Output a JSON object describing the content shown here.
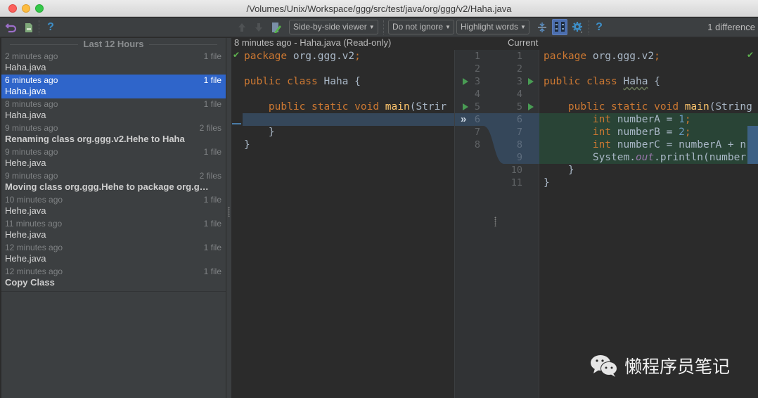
{
  "window": {
    "title": "/Volumes/Unix/Workspace/ggg/src/test/java/org/ggg/v2/Haha.java"
  },
  "left_toolbar": {
    "icons": [
      "revert-icon",
      "file-icon",
      "help-icon"
    ],
    "help_glyph": "?"
  },
  "right_toolbar": {
    "viewer_mode": "Side-by-side viewer",
    "ignore_mode": "Do not ignore",
    "highlight_mode": "Highlight words",
    "help_glyph": "?",
    "difference_count": "1 difference",
    "colors": {
      "accent_blue": "#3d8ec7",
      "selected_toggle": "#4b6eaf"
    }
  },
  "history": {
    "group_label": "Last 12 Hours",
    "revisions": [
      {
        "time": "2 minutes ago",
        "count": "1 file",
        "name": "Haha.java",
        "bold": false,
        "selected": false
      },
      {
        "time": "6 minutes ago",
        "count": "1 file",
        "name": "Haha.java",
        "bold": false,
        "selected": true
      },
      {
        "time": "8 minutes ago",
        "count": "1 file",
        "name": "Haha.java",
        "bold": false,
        "selected": false
      },
      {
        "time": "9 minutes ago",
        "count": "2 files",
        "name": "Renaming class org.ggg.v2.Hehe to Haha",
        "bold": true,
        "selected": false
      },
      {
        "time": "9 minutes ago",
        "count": "1 file",
        "name": "Hehe.java",
        "bold": false,
        "selected": false
      },
      {
        "time": "9 minutes ago",
        "count": "2 files",
        "name": "Moving class org.ggg.Hehe to package org.g…",
        "bold": true,
        "selected": false
      },
      {
        "time": "10 minutes ago",
        "count": "1 file",
        "name": "Hehe.java",
        "bold": false,
        "selected": false
      },
      {
        "time": "11 minutes ago",
        "count": "1 file",
        "name": "Hehe.java",
        "bold": false,
        "selected": false
      },
      {
        "time": "12 minutes ago",
        "count": "1 file",
        "name": "Hehe.java",
        "bold": false,
        "selected": false
      },
      {
        "time": "12 minutes ago",
        "count": "1 file",
        "name": "Copy Class",
        "bold": true,
        "selected": false
      }
    ],
    "selection_color": "#2f65ca"
  },
  "diff": {
    "left_header": "8 minutes ago - Haha.java (Read-only)",
    "right_header": "Current",
    "left_line_numbers": [
      "1",
      "2",
      "3",
      "4",
      "5",
      "6",
      "7",
      "8"
    ],
    "right_line_numbers": [
      "1",
      "2",
      "3",
      "4",
      "5",
      "6",
      "7",
      "8",
      "9",
      "10",
      "11"
    ],
    "left_code": {
      "l1_kw": "package",
      "l1_rest": " org.ggg.v2",
      "l1_semi": ";",
      "l3_kw": "public class",
      "l3_rest": " Haha {",
      "l5_indent": "    ",
      "l5_kw": "public static void",
      "l5_sp": " ",
      "l5_fn": "main",
      "l5_rest": "(Strir",
      "l7": "    }",
      "l8": "}"
    },
    "right_code": {
      "l1_kw": "package",
      "l1_rest": " org.ggg.v2",
      "l1_semi": ";",
      "l3_kw": "public class",
      "l3_sp": " ",
      "l3_cls": "Haha",
      "l3_rest": " {",
      "l5_indent": "    ",
      "l5_kw": "public static void",
      "l5_sp": " ",
      "l5_fn": "main",
      "l5_rest": "(String",
      "l6_indent": "        ",
      "l6_kw": "int",
      "l6_rest": " numberA = ",
      "l6_num": "1",
      "l6_semi": ";",
      "l7_indent": "        ",
      "l7_kw": "int",
      "l7_rest": " numberB = ",
      "l7_num": "2",
      "l7_semi": ";",
      "l8_indent": "        ",
      "l8_kw": "int",
      "l8_rest": " numberC = numberA + n",
      "l9_indent": "        ",
      "l9_a": "System.",
      "l9_static": "out",
      "l9_b": ".println(number",
      "l10": "    }",
      "l11": "}"
    },
    "colors": {
      "deleted_bg": "#35475a",
      "inserted_bg": "#294436",
      "keyword": "#cc7832",
      "function": "#ffc66d",
      "number": "#6897bb"
    }
  },
  "watermark": {
    "text": "懒程序员笔记",
    "icon": "wechat-icon"
  }
}
